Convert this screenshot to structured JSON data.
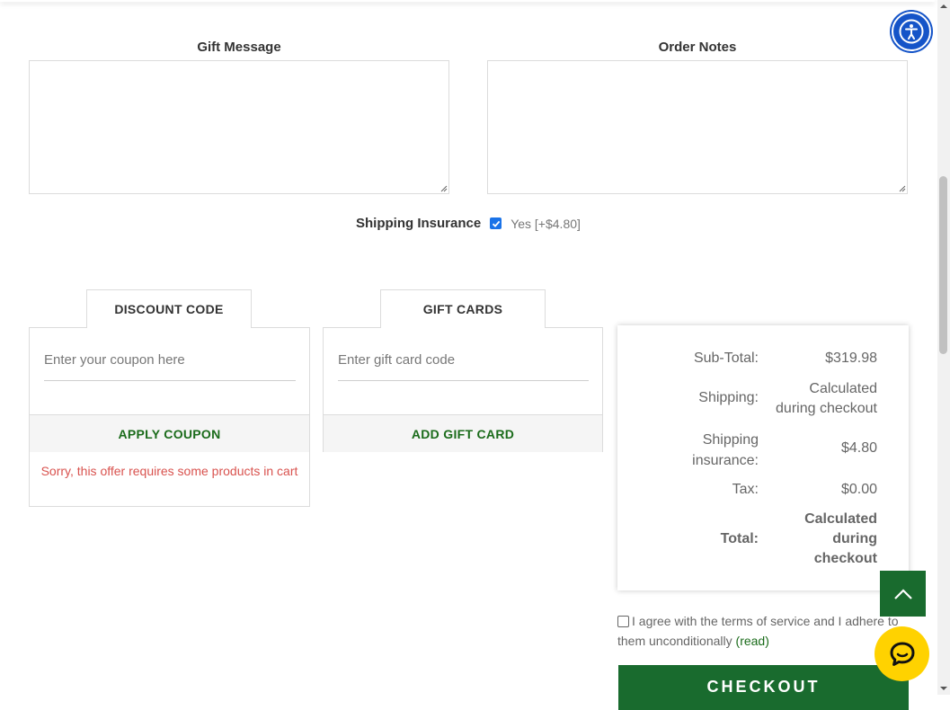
{
  "form": {
    "gift_message_label": "Gift Message",
    "order_notes_label": "Order Notes",
    "gift_message_value": "",
    "order_notes_value": ""
  },
  "insurance": {
    "label": "Shipping Insurance",
    "checked": true,
    "option": "Yes [+$4.80]"
  },
  "discount": {
    "tab_label": "DISCOUNT CODE",
    "placeholder": "Enter your coupon here",
    "button_label": "APPLY COUPON",
    "error": "Sorry, this offer requires some products in cart"
  },
  "gift_cards": {
    "tab_label": "GIFT CARDS",
    "placeholder": "Enter gift card code",
    "button_label": "ADD GIFT CARD"
  },
  "summary": {
    "subtotal_label": "Sub-Total:",
    "subtotal_value": "$319.98",
    "shipping_label": "Shipping:",
    "shipping_value_line1": "Calculated",
    "shipping_value_line2": "during checkout",
    "insurance_label_line1": "Shipping",
    "insurance_label_line2": "insurance:",
    "insurance_value": "$4.80",
    "tax_label": "Tax:",
    "tax_value": "$0.00",
    "total_label": "Total:",
    "total_value_line1": "Calculated",
    "total_value_line2": "during",
    "total_value_line3": "checkout"
  },
  "terms": {
    "text_line": "I agree with the terms of service and I adhere to them unconditionally",
    "link": "(read)",
    "checked": false
  },
  "checkout": {
    "label": "CHECKOUT"
  },
  "icons": {
    "accessibility": "accessibility-icon",
    "scroll_top": "chevron-up-icon",
    "chat": "chat-icon",
    "checkbox_checked": "checkmark-icon"
  },
  "colors": {
    "brand_green": "#196b2e",
    "accent_blue": "#1554c8",
    "error_red": "#d9534f",
    "chat_yellow": "#ffd200"
  }
}
